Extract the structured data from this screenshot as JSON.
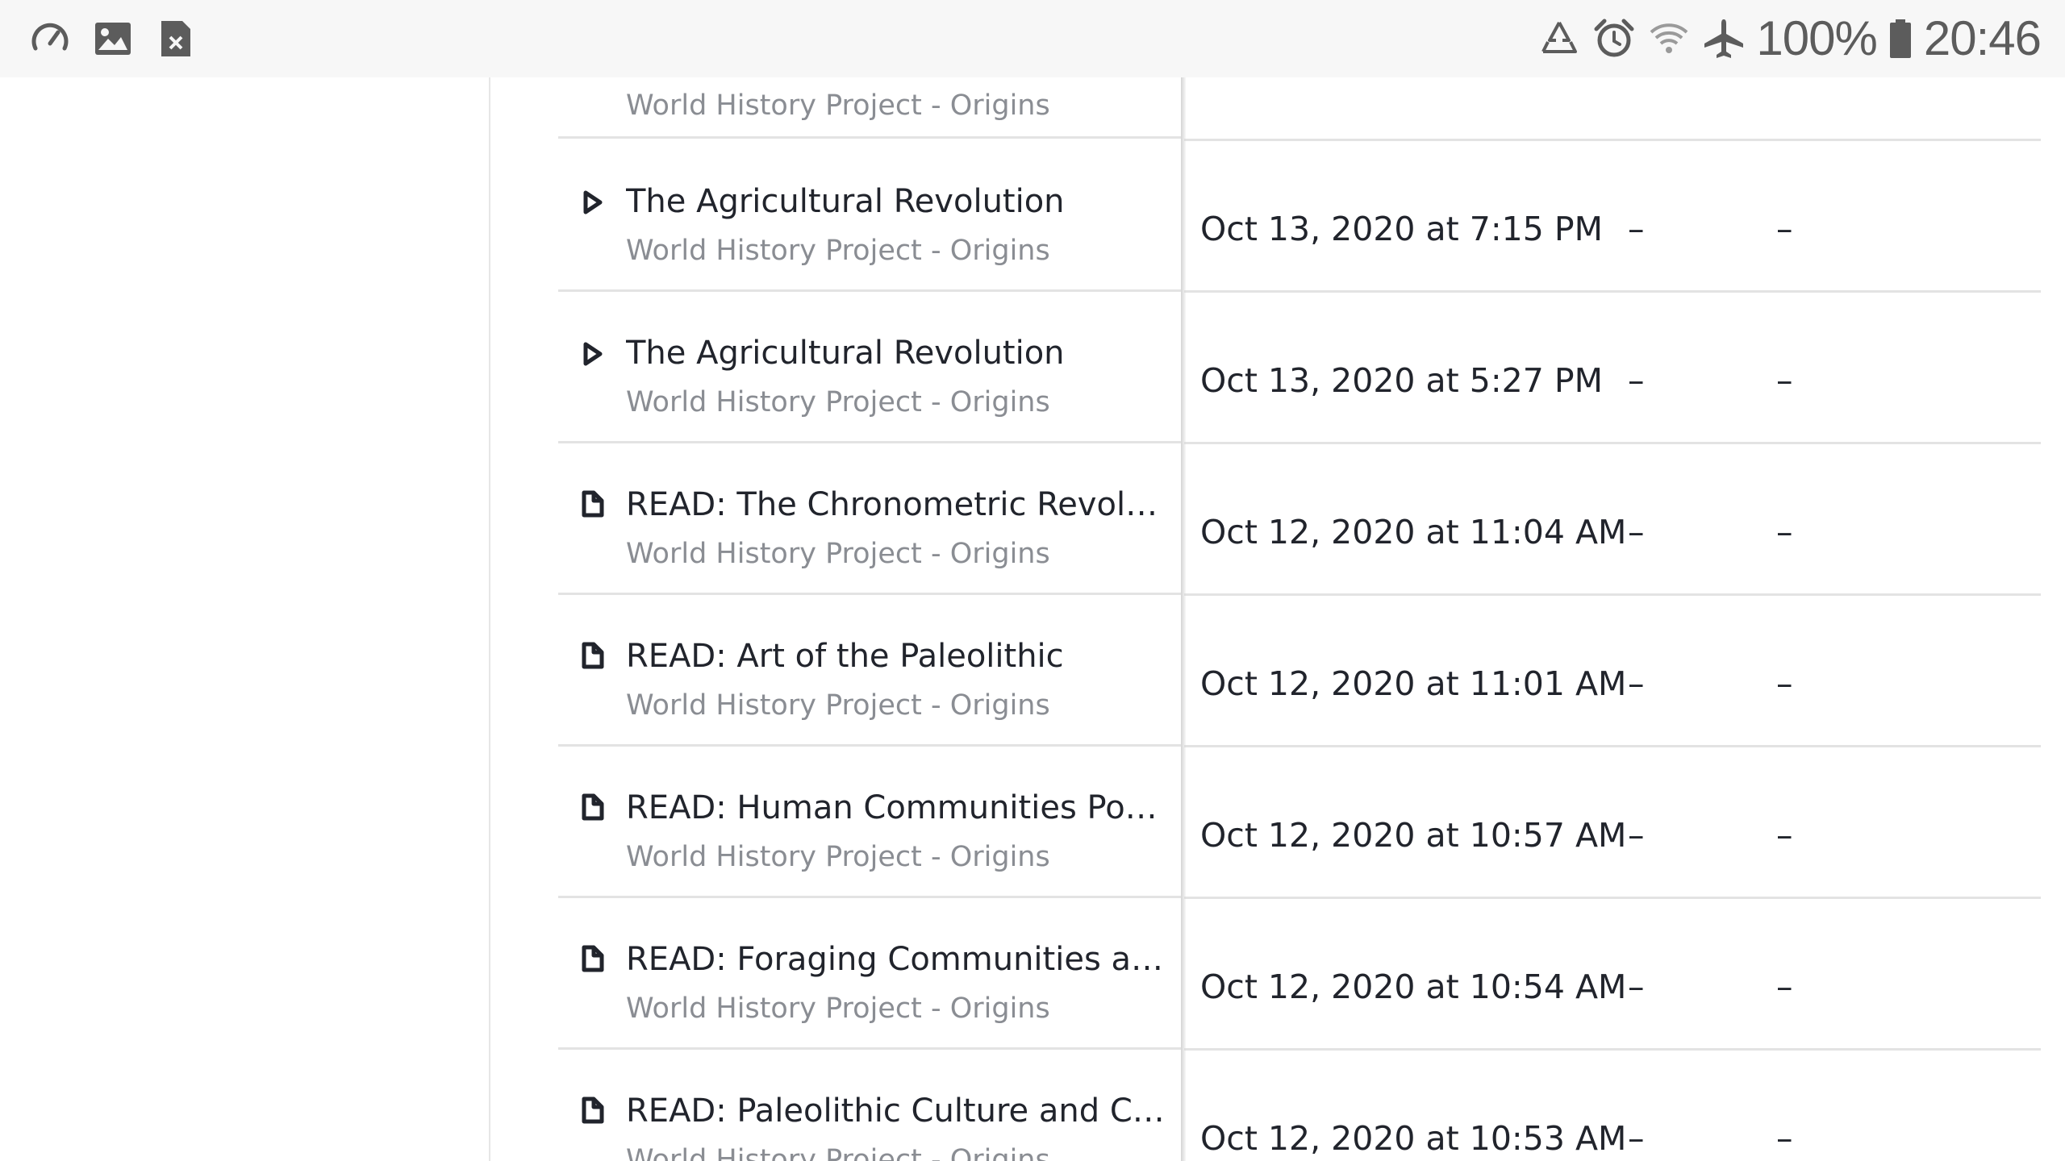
{
  "status_bar": {
    "left_icons": [
      "speedometer-icon",
      "image-icon",
      "file-close-icon"
    ],
    "right_icons": [
      "recycle-icon",
      "alarm-icon",
      "wifi-icon",
      "airplane-mode-icon"
    ],
    "battery": "100%",
    "time": "20:46"
  },
  "activity": {
    "partial_top_row": {
      "subtitle": "World History Project - Origins"
    },
    "rows": [
      {
        "type": "video",
        "icon": "play-icon",
        "title": "The Agricultural Revolution",
        "subtitle": "World History Project - Origins",
        "date": "Oct 13, 2020 at 7:15 PM",
        "col3": "–",
        "col4": "–"
      },
      {
        "type": "video",
        "icon": "play-icon",
        "title": "The Agricultural Revolution",
        "subtitle": "World History Project - Origins",
        "date": "Oct 13, 2020 at 5:27 PM",
        "col3": "–",
        "col4": "–"
      },
      {
        "type": "article",
        "icon": "article-icon",
        "title": "READ: The Chronometric Revoluti...",
        "subtitle": "World History Project - Origins",
        "date": "Oct 12, 2020 at 11:04 AM",
        "col3": "–",
        "col4": "–"
      },
      {
        "type": "article",
        "icon": "article-icon",
        "title": "READ: Art of the Paleolithic",
        "subtitle": "World History Project - Origins",
        "date": "Oct 12, 2020 at 11:01 AM",
        "col3": "–",
        "col4": "–"
      },
      {
        "type": "article",
        "icon": "article-icon",
        "title": "READ: Human Communities Popul...",
        "subtitle": "World History Project - Origins",
        "date": "Oct 12, 2020 at 10:57 AM",
        "col3": "–",
        "col4": "–"
      },
      {
        "type": "article",
        "icon": "article-icon",
        "title": "READ: Foraging Communities and ...",
        "subtitle": "World History Project - Origins",
        "date": "Oct 12, 2020 at 10:54 AM",
        "col3": "–",
        "col4": "–"
      },
      {
        "type": "article",
        "icon": "article-icon",
        "title": "READ: Paleolithic Culture and Co...",
        "subtitle": "World History Project - Origins",
        "date": "Oct 12, 2020 at 10:53 AM",
        "col3": "–",
        "col4": "–"
      }
    ]
  }
}
